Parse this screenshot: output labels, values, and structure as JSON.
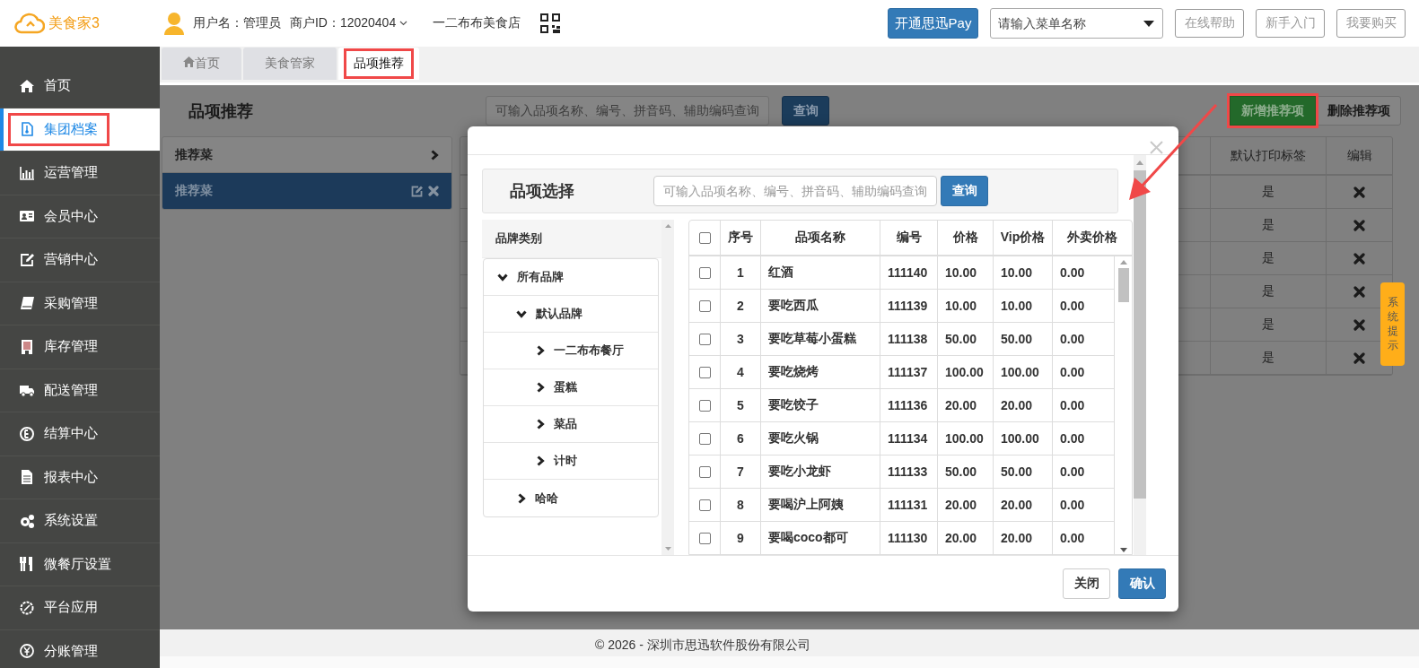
{
  "header": {
    "logo": "美食家3",
    "user": "用户名：管理员",
    "merchant": "商户ID：12020404",
    "store": "一二布布美食店",
    "pay_button": "开通思迅Pay",
    "menu_search": {
      "placeholder": "请输入菜单名称"
    },
    "buttons": [
      "在线帮助",
      "新手入门",
      "我要购买"
    ]
  },
  "sidebar": {
    "items": [
      {
        "label": "首页",
        "selected": false,
        "highlighted": false
      },
      {
        "label": "集团档案",
        "selected": true,
        "highlighted": true
      },
      {
        "label": "运营管理",
        "selected": false,
        "highlighted": false
      },
      {
        "label": "会员中心",
        "selected": false,
        "highlighted": false
      },
      {
        "label": "营销中心",
        "selected": false,
        "highlighted": false
      },
      {
        "label": "采购管理",
        "selected": false,
        "highlighted": false
      },
      {
        "label": "库存管理",
        "selected": false,
        "highlighted": false
      },
      {
        "label": "配送管理",
        "selected": false,
        "highlighted": false
      },
      {
        "label": "结算中心",
        "selected": false,
        "highlighted": false
      },
      {
        "label": "报表中心",
        "selected": false,
        "highlighted": false
      },
      {
        "label": "系统设置",
        "selected": false,
        "highlighted": false
      },
      {
        "label": "微餐厅设置",
        "selected": false,
        "highlighted": false
      },
      {
        "label": "平台应用",
        "selected": false,
        "highlighted": false
      },
      {
        "label": "分账管理",
        "selected": false,
        "highlighted": false
      }
    ]
  },
  "tabs": [
    {
      "label": "首页",
      "kind": "home",
      "selected": false,
      "highlighted": false
    },
    {
      "label": "美食管家",
      "kind": "plain",
      "selected": false,
      "highlighted": false
    },
    {
      "label": "品项推荐",
      "kind": "plain",
      "selected": true,
      "highlighted": true
    }
  ],
  "page": {
    "title": "品项推荐",
    "search": {
      "placeholder": "可输入品项名称、编号、拼音码、辅助编码查询"
    },
    "search_button": "查询",
    "actions": [
      {
        "label": "新增推荐项",
        "kind": "primary",
        "highlighted": true
      },
      {
        "label": "删除推荐项",
        "kind": "default",
        "highlighted": false
      }
    ],
    "groups": {
      "title": "推荐菜",
      "items": [
        {
          "label": "推荐菜",
          "selected": true
        }
      ]
    },
    "table": {
      "columns": [
        "默认打印标签",
        "编辑"
      ],
      "rows": [
        {
          "print_label": "是"
        },
        {
          "print_label": "是"
        },
        {
          "print_label": "是"
        },
        {
          "print_label": "是"
        },
        {
          "print_label": "是"
        },
        {
          "print_label": "是"
        }
      ]
    }
  },
  "modal": {
    "title": "品项选择",
    "search": {
      "placeholder": "可输入品项名称、编号、拼音码、辅助编码查询"
    },
    "search_button": "查询",
    "tree_title": "品牌类别",
    "tree": [
      {
        "label": "所有品牌",
        "expanded": true,
        "children": [
          {
            "label": "默认品牌",
            "expanded": true,
            "children": [
              {
                "label": "一二布布餐厅",
                "expanded": false
              },
              {
                "label": "蛋糕",
                "expanded": false
              },
              {
                "label": "菜品",
                "expanded": false
              },
              {
                "label": "计时",
                "expanded": false
              }
            ]
          },
          {
            "label": "哈哈",
            "expanded": false
          }
        ]
      }
    ],
    "table": {
      "select_all_checked": false,
      "columns": [
        "序号",
        "品项名称",
        "编号",
        "价格",
        "Vip价格",
        "外卖价格"
      ],
      "rows": [
        {
          "checked": false,
          "no": "1",
          "name": "红酒",
          "code": "111140",
          "price": "10.00",
          "vip_price": "10.00",
          "takeout_price": "0.00"
        },
        {
          "checked": false,
          "no": "2",
          "name": "要吃西瓜",
          "code": "111139",
          "price": "10.00",
          "vip_price": "10.00",
          "takeout_price": "0.00"
        },
        {
          "checked": false,
          "no": "3",
          "name": "要吃草莓小蛋糕",
          "code": "111138",
          "price": "50.00",
          "vip_price": "50.00",
          "takeout_price": "0.00"
        },
        {
          "checked": false,
          "no": "4",
          "name": "要吃烧烤",
          "code": "111137",
          "price": "100.00",
          "vip_price": "100.00",
          "takeout_price": "0.00"
        },
        {
          "checked": false,
          "no": "5",
          "name": "要吃饺子",
          "code": "111136",
          "price": "20.00",
          "vip_price": "20.00",
          "takeout_price": "0.00"
        },
        {
          "checked": false,
          "no": "6",
          "name": "要吃火锅",
          "code": "111134",
          "price": "100.00",
          "vip_price": "100.00",
          "takeout_price": "0.00"
        },
        {
          "checked": false,
          "no": "7",
          "name": "要吃小龙虾",
          "code": "111133",
          "price": "50.00",
          "vip_price": "50.00",
          "takeout_price": "0.00"
        },
        {
          "checked": false,
          "no": "8",
          "name": "要喝沪上阿姨",
          "code": "111131",
          "price": "20.00",
          "vip_price": "20.00",
          "takeout_price": "0.00"
        },
        {
          "checked": false,
          "no": "9",
          "name": "要喝coco都可",
          "code": "111130",
          "price": "20.00",
          "vip_price": "20.00",
          "takeout_price": "0.00"
        }
      ]
    },
    "buttons": [
      {
        "label": "关闭",
        "kind": "default"
      },
      {
        "label": "确认",
        "kind": "primary"
      }
    ]
  },
  "notice_tab": "系统提示",
  "footer": "© 2026 - 深圳市思迅软件股份有限公司"
}
